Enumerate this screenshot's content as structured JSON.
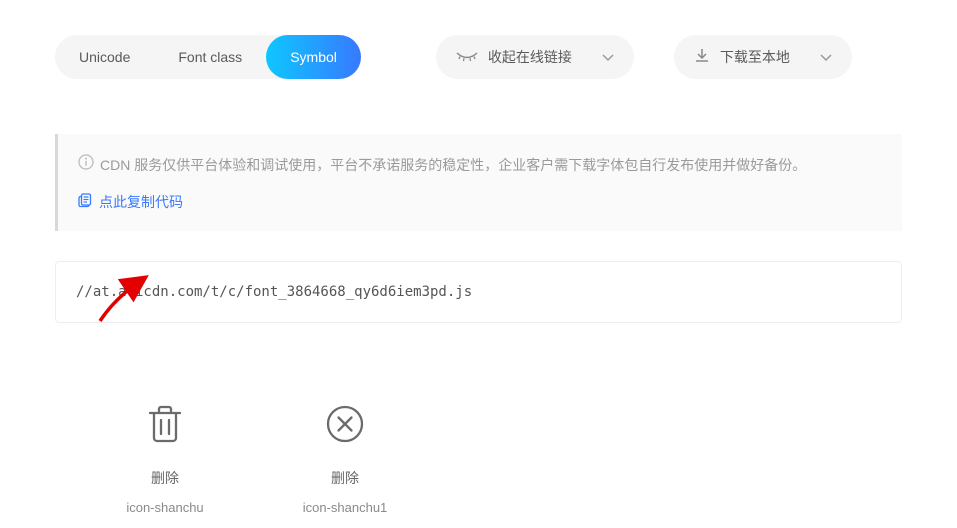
{
  "tabs": {
    "unicode": "Unicode",
    "fontclass": "Font class",
    "symbol": "Symbol"
  },
  "actions": {
    "collapse_link": "收起在线链接",
    "download_local": "下载至本地"
  },
  "notice": {
    "text": "CDN 服务仅供平台体验和调试使用，平台不承诺服务的稳定性，企业客户需下载字体包自行发布使用并做好备份。",
    "copy_label": "点此复制代码"
  },
  "code": {
    "url": "//at.alicdn.com/t/c/font_3864668_qy6d6iem3pd.js"
  },
  "icons": [
    {
      "label": "删除",
      "classname": "icon-shanchu"
    },
    {
      "label": "删除",
      "classname": "icon-shanchu1"
    }
  ]
}
